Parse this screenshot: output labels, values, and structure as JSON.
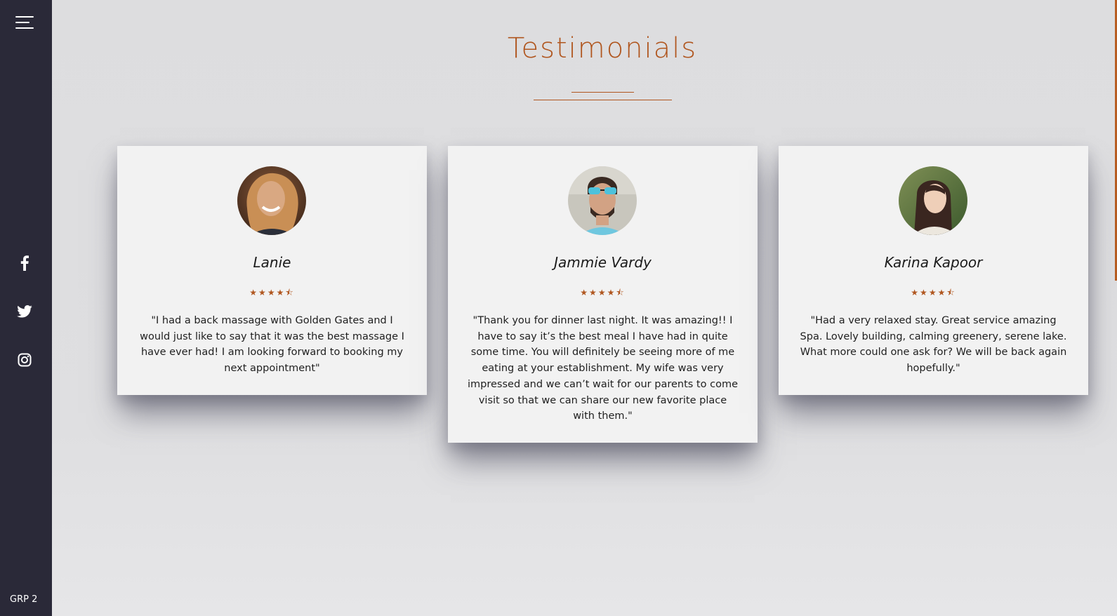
{
  "sidebar": {
    "menu_icon": "hamburger-menu-icon",
    "social": [
      {
        "name": "facebook",
        "icon": "facebook-icon"
      },
      {
        "name": "twitter",
        "icon": "twitter-icon"
      },
      {
        "name": "instagram",
        "icon": "instagram-icon"
      }
    ],
    "footer_label": "GRP 2"
  },
  "section": {
    "title": "Testimonials",
    "accent_color": "#b0561f"
  },
  "testimonials": [
    {
      "name": "Lanie",
      "rating": 4.5,
      "stars": "★★★★⯪",
      "quote": "\"I had a back massage with Golden Gates and I would just like to say that it was the best massage I have ever had! I am looking forward to booking my next appointment\""
    },
    {
      "name": "Jammie Vardy",
      "rating": 4.5,
      "stars": "★★★★⯪",
      "quote": "\"Thank you for dinner last night. It was amazing!! I have to say it’s the best meal I have had in quite some time. You will definitely be seeing more of me eating at your establishment. My wife was very impressed and we can’t wait for our parents to come visit so that we can share our new favorite place with them.\""
    },
    {
      "name": "Karina Kapoor",
      "rating": 4.5,
      "stars": "★★★★⯪",
      "quote": "\"Had a very relaxed stay. Great service amazing Spa. Lovely building, calming greenery, serene lake. What more could one ask for? We will be back again hopefully.\""
    }
  ]
}
